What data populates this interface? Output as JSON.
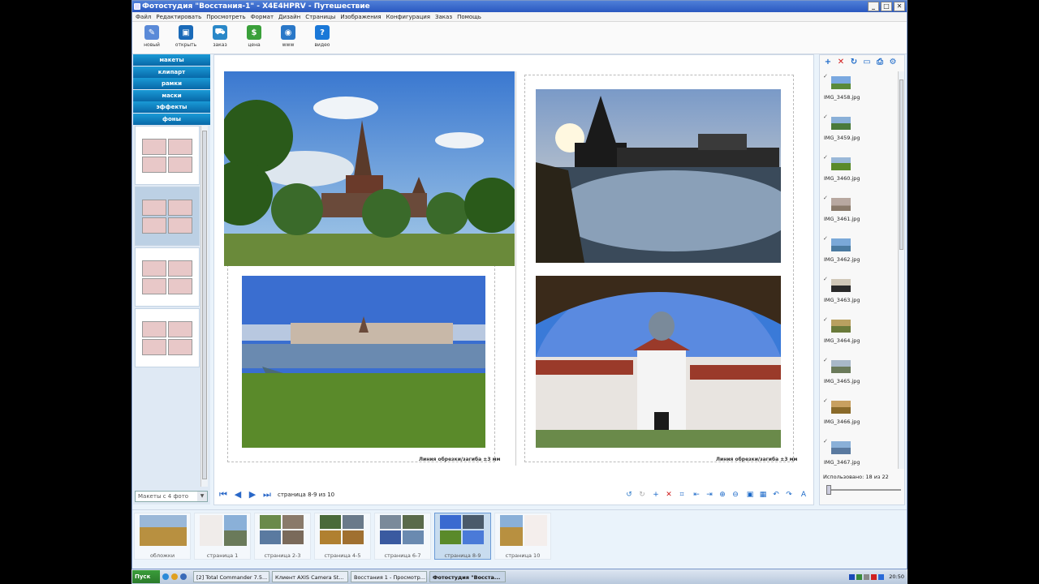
{
  "window": {
    "title": "Фотостудия \"Восстания-1\" - X4E4HPRV - Путешествие",
    "min": "_",
    "max": "□",
    "close": "✕"
  },
  "menu": [
    "Файл",
    "Редактировать",
    "Просмотреть",
    "Формат",
    "Дизайн",
    "Страницы",
    "Изображения",
    "Конфигурация",
    "Заказ",
    "Помощь"
  ],
  "toolbar": [
    {
      "label": "новый",
      "icon": "new-document-icon",
      "color": "#5a8ad8",
      "glyph": "✎"
    },
    {
      "label": "открыть",
      "icon": "open-folder-icon",
      "color": "#1a6ab8",
      "glyph": "▣"
    },
    {
      "label": "заказ",
      "icon": "cart-icon",
      "color": "#2a88c8",
      "glyph": "⛟"
    },
    {
      "label": "цена",
      "icon": "coins-icon",
      "color": "#3aa03a",
      "glyph": "$"
    },
    {
      "label": "www",
      "icon": "globe-icon",
      "color": "#2a78c8",
      "glyph": "◉"
    },
    {
      "label": "видео",
      "icon": "help-icon",
      "color": "#1a78d8",
      "glyph": "?"
    }
  ],
  "categories": [
    "макеты",
    "клипарт",
    "рамки",
    "маски",
    "эффекты",
    "фоны"
  ],
  "layout_filter": "Макеты с 4 фото",
  "fold_line_text": "Линия обрезки/загиба ±3 мм",
  "page_indicator": "страница 8-9 из 10",
  "files": [
    "IMG_3458.jpg",
    "IMG_3459.jpg",
    "IMG_3460.jpg",
    "IMG_3461.jpg",
    "IMG_3462.jpg",
    "IMG_3463.jpg",
    "IMG_3464.jpg",
    "IMG_3465.jpg",
    "IMG_3466.jpg",
    "IMG_3467.jpg"
  ],
  "used_text": "Использовано: 18 из 22",
  "filmstrip": [
    "обложки",
    "страница 1",
    "страница 2-3",
    "страница 4-5",
    "страница 6-7",
    "страница 8-9",
    "страница 10"
  ],
  "taskbar": {
    "start": "Пуск",
    "tasks": [
      "[2] Total Commander 7.5...",
      "Клиент AXIS Camera St...",
      "Восстания 1 - Просмотр...",
      "Фотостудия \"Восста..."
    ],
    "clock": "20:50"
  }
}
